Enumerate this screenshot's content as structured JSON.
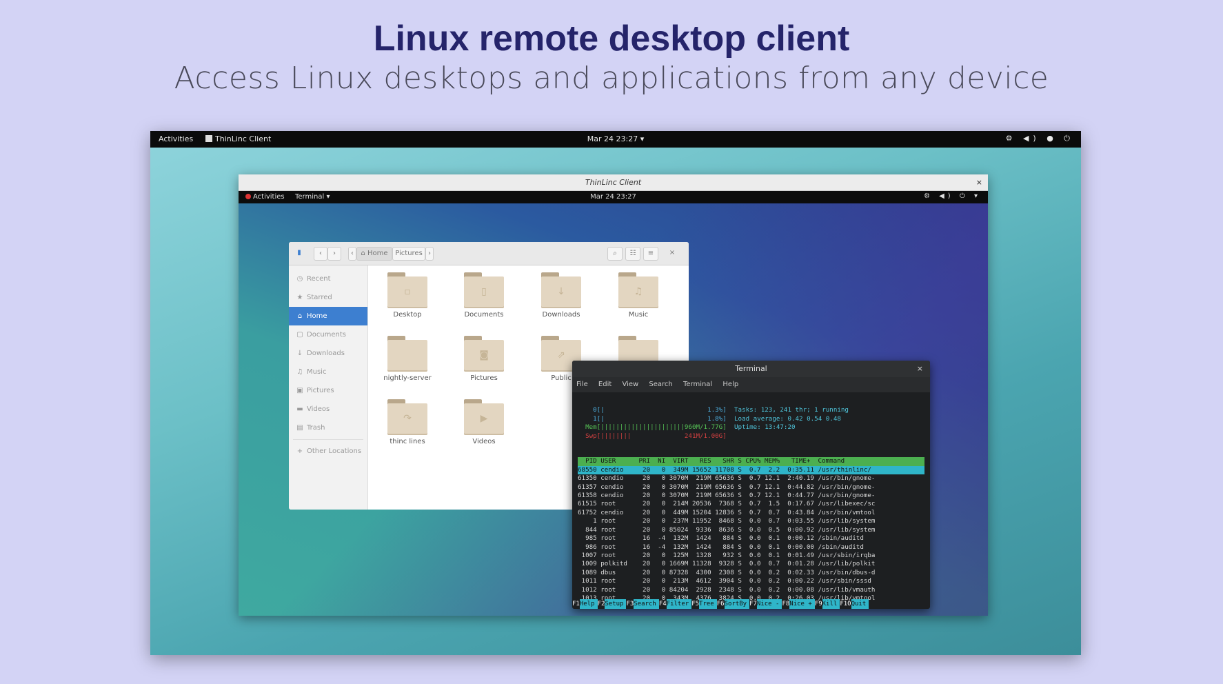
{
  "hero": {
    "title": "Linux remote desktop client",
    "subtitle": "Access Linux desktops and applications from any device"
  },
  "outer_topbar": {
    "activities": "Activities",
    "app": "ThinLinc Client",
    "clock": "Mar 24 23:27",
    "clock_arrow": "▾",
    "tray": "⚙ ◀) ● ⏻"
  },
  "client": {
    "title": "ThinLinc Client",
    "close": "×",
    "activities": "Activities",
    "terminal_menu": "Terminal ▾",
    "clock": "Mar 24 23:27",
    "tray": "⚙ ◀) ⏻ ▾"
  },
  "files": {
    "breadcrumb": [
      "⌂ Home",
      "Pictures"
    ],
    "sidebar": [
      {
        "icon": "◷",
        "label": "Recent"
      },
      {
        "icon": "★",
        "label": "Starred"
      },
      {
        "icon": "⌂",
        "label": "Home"
      },
      {
        "icon": "▢",
        "label": "Documents"
      },
      {
        "icon": "↓",
        "label": "Downloads"
      },
      {
        "icon": "♫",
        "label": "Music"
      },
      {
        "icon": "▣",
        "label": "Pictures"
      },
      {
        "icon": "▬",
        "label": "Videos"
      },
      {
        "icon": "▤",
        "label": "Trash"
      },
      {
        "icon": "+",
        "label": "Other Locations"
      }
    ],
    "folders": [
      {
        "label": "Desktop",
        "emblem": "▫"
      },
      {
        "label": "Documents",
        "emblem": "▯"
      },
      {
        "label": "Downloads",
        "emblem": "↓"
      },
      {
        "label": "Music",
        "emblem": "♫"
      },
      {
        "label": "nightly-server",
        "emblem": ""
      },
      {
        "label": "Pictures",
        "emblem": "◙"
      },
      {
        "label": "Public",
        "emblem": "⇗"
      },
      {
        "label": "",
        "emblem": ""
      },
      {
        "label": "thinc lines",
        "emblem": "↷"
      },
      {
        "label": "Videos",
        "emblem": "▶"
      }
    ]
  },
  "terminal": {
    "title": "Terminal",
    "close": "×",
    "menu": [
      "File",
      "Edit",
      "View",
      "Search",
      "Terminal",
      "Help"
    ],
    "meters": [
      "    0[|                           1.3%]",
      "    1[|                           1.8%]",
      "  Mem[||||||||||||||||||||||960M/1.77G]",
      "  Swp[||||||||              241M/1.00G]"
    ],
    "summary": [
      "Tasks: 123, 241 thr; 1 running",
      "Load average: 0.42 0.54 0.48",
      "Uptime: 13:47:20"
    ],
    "header": "  PID USER      PRI  NI  VIRT   RES   SHR S CPU% MEM%   TIME+  Command",
    "selected": "68550 cendio     20   0  349M 15652 11708 S  0.7  2.2  0:35.11 /usr/thinlinc/",
    "rows": [
      "61350 cendio     20   0 3070M  219M 65636 S  0.7 12.1  2:40.19 /usr/bin/gnome-",
      "61357 cendio     20   0 3070M  219M 65636 S  0.7 12.1  0:44.82 /usr/bin/gnome-",
      "61358 cendio     20   0 3070M  219M 65636 S  0.7 12.1  0:44.77 /usr/bin/gnome-",
      "61515 root       20   0  214M 20536  7368 S  0.7  1.5  0:17.67 /usr/libexec/sc",
      "61752 cendio     20   0  449M 15204 12836 S  0.7  0.7  0:43.84 /usr/bin/vmtool",
      "    1 root       20   0  237M 11952  8468 S  0.0  0.7  0:03.55 /usr/lib/system",
      "  844 root       20   0 85024  9336  8636 S  0.0  0.5  0:00.92 /usr/lib/system",
      "  985 root       16  -4  132M  1424   884 S  0.0  0.1  0:00.12 /sbin/auditd",
      "  986 root       16  -4  132M  1424   884 S  0.0  0.1  0:00.00 /sbin/auditd",
      " 1007 root       20   0  125M  1328   932 S  0.0  0.1  0:01.49 /usr/sbin/irqba",
      " 1009 polkitd    20   0 1669M 11328  9328 S  0.0  0.7  0:01.28 /usr/lib/polkit",
      " 1089 dbus       20   0 87328  4300  2308 S  0.0  0.2  0:02.33 /usr/bin/dbus-d",
      " 1011 root       20   0  213M  4612  3904 S  0.0  0.2  0:00.22 /usr/sbin/sssd",
      " 1012 root       20   0 84204  2928  2348 S  0.0  0.2  0:00.08 /usr/lib/vmauth",
      " 1013 root       20   0  343M  4376  3824 S  0.0  0.2  0:26.03 /usr/lib/vmtool"
    ],
    "fkeys": [
      {
        "k": "F1",
        "l": "Help"
      },
      {
        "k": "F2",
        "l": "Setup"
      },
      {
        "k": "F3",
        "l": "Search"
      },
      {
        "k": "F4",
        "l": "Filter"
      },
      {
        "k": "F5",
        "l": "Tree"
      },
      {
        "k": "F6",
        "l": "SortBy"
      },
      {
        "k": "F7",
        "l": "Nice -"
      },
      {
        "k": "F8",
        "l": "Nice +"
      },
      {
        "k": "F9",
        "l": "Kill"
      },
      {
        "k": "F10",
        "l": "Quit"
      }
    ]
  }
}
